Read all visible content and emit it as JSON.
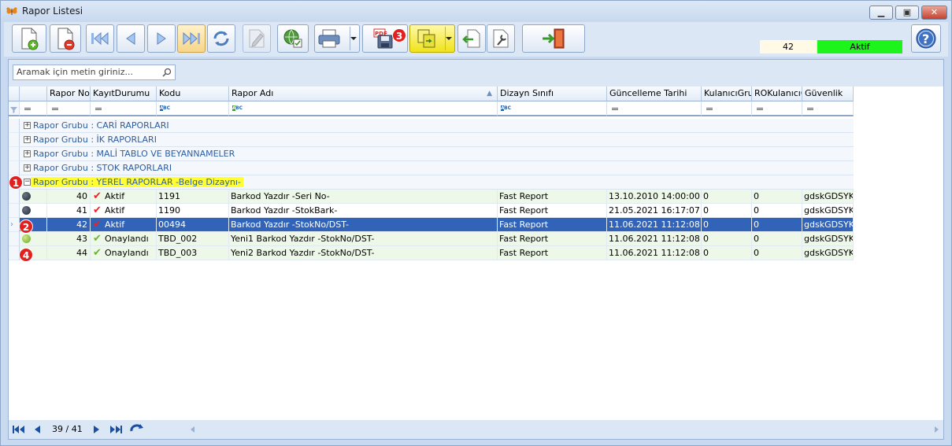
{
  "window": {
    "title": "Rapor Listesi"
  },
  "toolbar": {
    "record_count": "42",
    "status": "Aktif",
    "status_color": "#1cf41c",
    "highlight_color": "#ffff33",
    "badge_color": "#e32020",
    "badges": {
      "b1": "1",
      "b2": "2",
      "b3": "3",
      "b4": "4"
    }
  },
  "search": {
    "placeholder": "Aramak için metin giriniz..."
  },
  "columns": [
    "Rapor No",
    "KayıtDurumu",
    "Kodu",
    "Rapor Adı",
    "Dizayn Sınıfı",
    "Güncelleme Tarihi",
    "KulanıcıGrup",
    "ROKulanıcıGr",
    "Güvenlik"
  ],
  "groups": [
    {
      "label": "Rapor Grubu : CARİ RAPORLARI",
      "expander": "+"
    },
    {
      "label": "Rapor Grubu : İK RAPORLARI",
      "expander": "+"
    },
    {
      "label": "Rapor Grubu : MALİ TABLO VE BEYANNAMELER",
      "expander": "+"
    },
    {
      "label": "Rapor Grubu : STOK RAPORLARI",
      "expander": "+"
    },
    {
      "label": "Rapor Grubu : YEREL RAPORLAR -Belge Dizaynı-",
      "expander": "−"
    }
  ],
  "rows": [
    {
      "no": "40",
      "status": "Aktif",
      "code": "1191",
      "name": "Barkod Yazdır -Seri No-",
      "design": "Fast Report",
      "date": "13.10.2010 14:00:00",
      "grp": "0",
      "rogrp": "0",
      "security": "gdskGDSYK"
    },
    {
      "no": "41",
      "status": "Aktif",
      "code": "1190",
      "name": "Barkod Yazdır -StokBark-",
      "design": "Fast Report",
      "date": "21.05.2021 16:17:07",
      "grp": "0",
      "rogrp": "0",
      "security": "gdskGDSYK"
    },
    {
      "no": "42",
      "status": "Aktif",
      "code": "00494",
      "name": "Barkod Yazdır -StokNo/DST-",
      "design": "Fast Report",
      "date": "11.06.2021 11:12:08",
      "grp": "0",
      "rogrp": "0",
      "security": "gdskGDSYK"
    },
    {
      "no": "43",
      "status": "Onaylandı",
      "code": "TBD_002",
      "name": "Yeni1 Barkod Yazdır -StokNo/DST-",
      "design": "Fast Report",
      "date": "11.06.2021 11:12:08",
      "grp": "0",
      "rogrp": "0",
      "security": "gdskGDSYK"
    },
    {
      "no": "44",
      "status": "Onaylandı",
      "code": "TBD_003",
      "name": "Yeni2 Barkod Yazdır -StokNo/DST-",
      "design": "Fast Report",
      "date": "11.06.2021 11:12:08",
      "grp": "0",
      "rogrp": "0",
      "security": "gdskGDSYK"
    }
  ],
  "footer": {
    "pager": "39 / 41"
  }
}
